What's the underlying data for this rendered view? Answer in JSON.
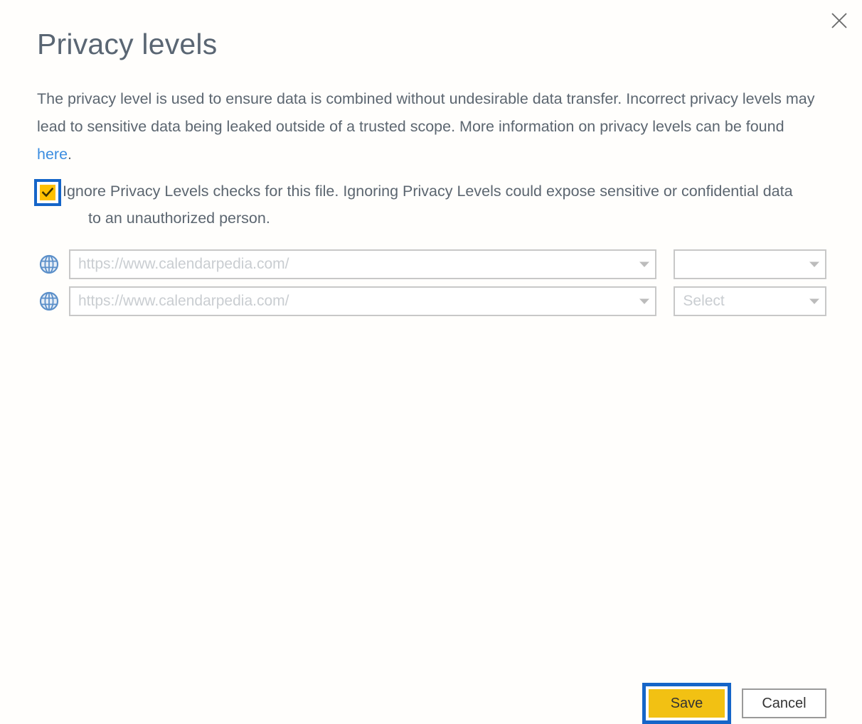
{
  "dialog": {
    "title": "Privacy levels",
    "close_label": "Close",
    "description": {
      "text_before_link": "The privacy level is used to ensure data is combined without undesirable data transfer. Incorrect privacy levels may lead to sensitive data being leaked outside of a trusted scope. More information on privacy levels can be found ",
      "link_text": "here",
      "text_after_link": "."
    },
    "checkbox": {
      "checked": true,
      "label_line1": "Ignore Privacy Levels checks for this file. Ignoring Privacy Levels could expose sensitive or confidential data",
      "label_line2": "to an unauthorized person.",
      "icon": "checkmark-icon",
      "fill_color": "#FFC000",
      "highlight_color": "#1565C8"
    },
    "sources": [
      {
        "icon": "globe-icon",
        "url_value": "https://www.calendarpedia.com/",
        "url_caret": "chevron-down-icon",
        "level_value": "",
        "level_placeholder": "",
        "level_caret": "chevron-down-icon"
      },
      {
        "icon": "globe-icon",
        "url_value": "https://www.calendarpedia.com/",
        "url_caret": "chevron-down-icon",
        "level_value": "Select",
        "level_placeholder": "Select",
        "level_caret": "chevron-down-icon"
      }
    ],
    "buttons": {
      "save_label": "Save",
      "save_color": "#F2C113",
      "save_highlight_color": "#1565C8",
      "cancel_label": "Cancel"
    },
    "colors": {
      "background": "#FFFEFC",
      "title_text": "#5A6673",
      "body_text": "#5C6670",
      "link": "#3B8DE0",
      "field_border": "#C8C8C8",
      "placeholder": "#C9CDD1",
      "globe": "#5B8FC9"
    }
  }
}
